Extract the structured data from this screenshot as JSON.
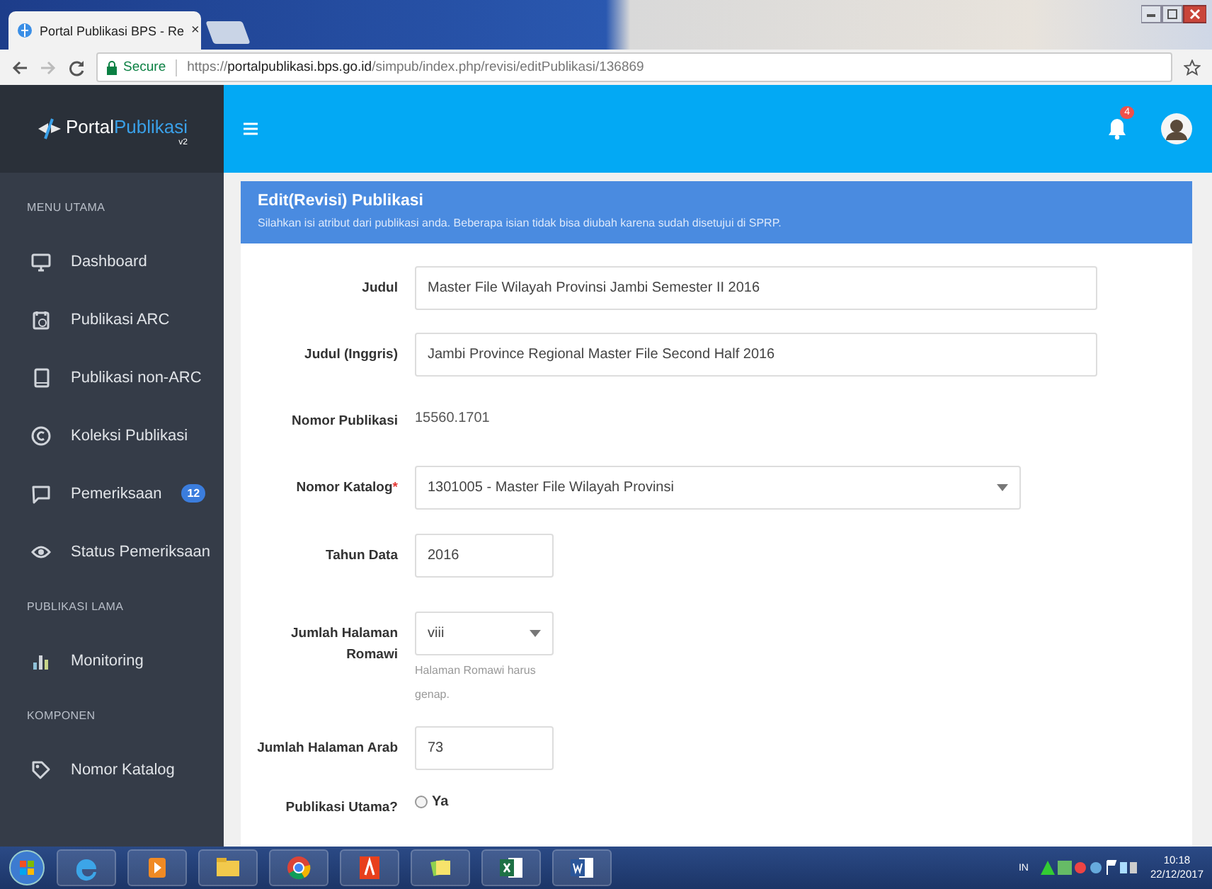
{
  "browser": {
    "tab_title": "Portal Publikasi BPS - Re",
    "tab_close": "×",
    "security": "Secure",
    "url_scheme": "https://",
    "url_host": "portalpublikasi.bps.go.id",
    "url_path": "/simpub/index.php/revisi/editPublikasi/136869"
  },
  "logo": {
    "part1": "Portal",
    "part2": "Publikasi",
    "version": "v2"
  },
  "topbar": {
    "notification_count": "4"
  },
  "sidebar": {
    "items": [
      {
        "kind": "section",
        "label": "MENU UTAMA"
      },
      {
        "kind": "link",
        "label": "Dashboard"
      },
      {
        "kind": "link",
        "label": "Publikasi ARC"
      },
      {
        "kind": "link",
        "label": "Publikasi non-ARC"
      },
      {
        "kind": "link",
        "label": "Koleksi Publikasi"
      },
      {
        "kind": "link",
        "label": "Pemeriksaan",
        "badge": "12"
      },
      {
        "kind": "link",
        "label": "Status Pemeriksaan"
      },
      {
        "kind": "section",
        "label": "PUBLIKASI LAMA"
      },
      {
        "kind": "link",
        "label": "Monitoring"
      },
      {
        "kind": "section",
        "label": "KOMPONEN"
      },
      {
        "kind": "link",
        "label": "Nomor Katalog"
      }
    ]
  },
  "form": {
    "title": "Edit(Revisi) Publikasi",
    "subtitle": "Silahkan isi atribut dari publikasi anda. Beberapa isian tidak bisa diubah karena sudah disetujui di SPRP.",
    "fields": [
      {
        "kind": "text",
        "label": "Judul",
        "value": "Master File Wilayah Provinsi Jambi Semester II 2016"
      },
      {
        "kind": "text",
        "label": "Judul (Inggris)",
        "value": "Jambi Province Regional Master File Second Half 2016"
      },
      {
        "kind": "static",
        "label": "Nomor Publikasi",
        "value": "15560.1701"
      },
      {
        "kind": "select",
        "label": "Nomor Katalog",
        "required_mark": "*",
        "value": "1301005 - Master File Wilayah Provinsi"
      },
      {
        "kind": "text",
        "label": "Tahun Data",
        "value": "2016"
      },
      {
        "kind": "select",
        "label": "Jumlah Halaman Romawi",
        "value": "viii",
        "help": "Halaman Romawi harus genap."
      },
      {
        "kind": "text",
        "label": "Jumlah Halaman Arab",
        "value": "73"
      },
      {
        "kind": "radio",
        "label": "Publikasi Utama?",
        "options": [
          {
            "label": "Ya",
            "selected": false
          }
        ]
      }
    ]
  },
  "taskbar": {
    "language": "IN",
    "time": "10:18",
    "date": "22/12/2017"
  }
}
